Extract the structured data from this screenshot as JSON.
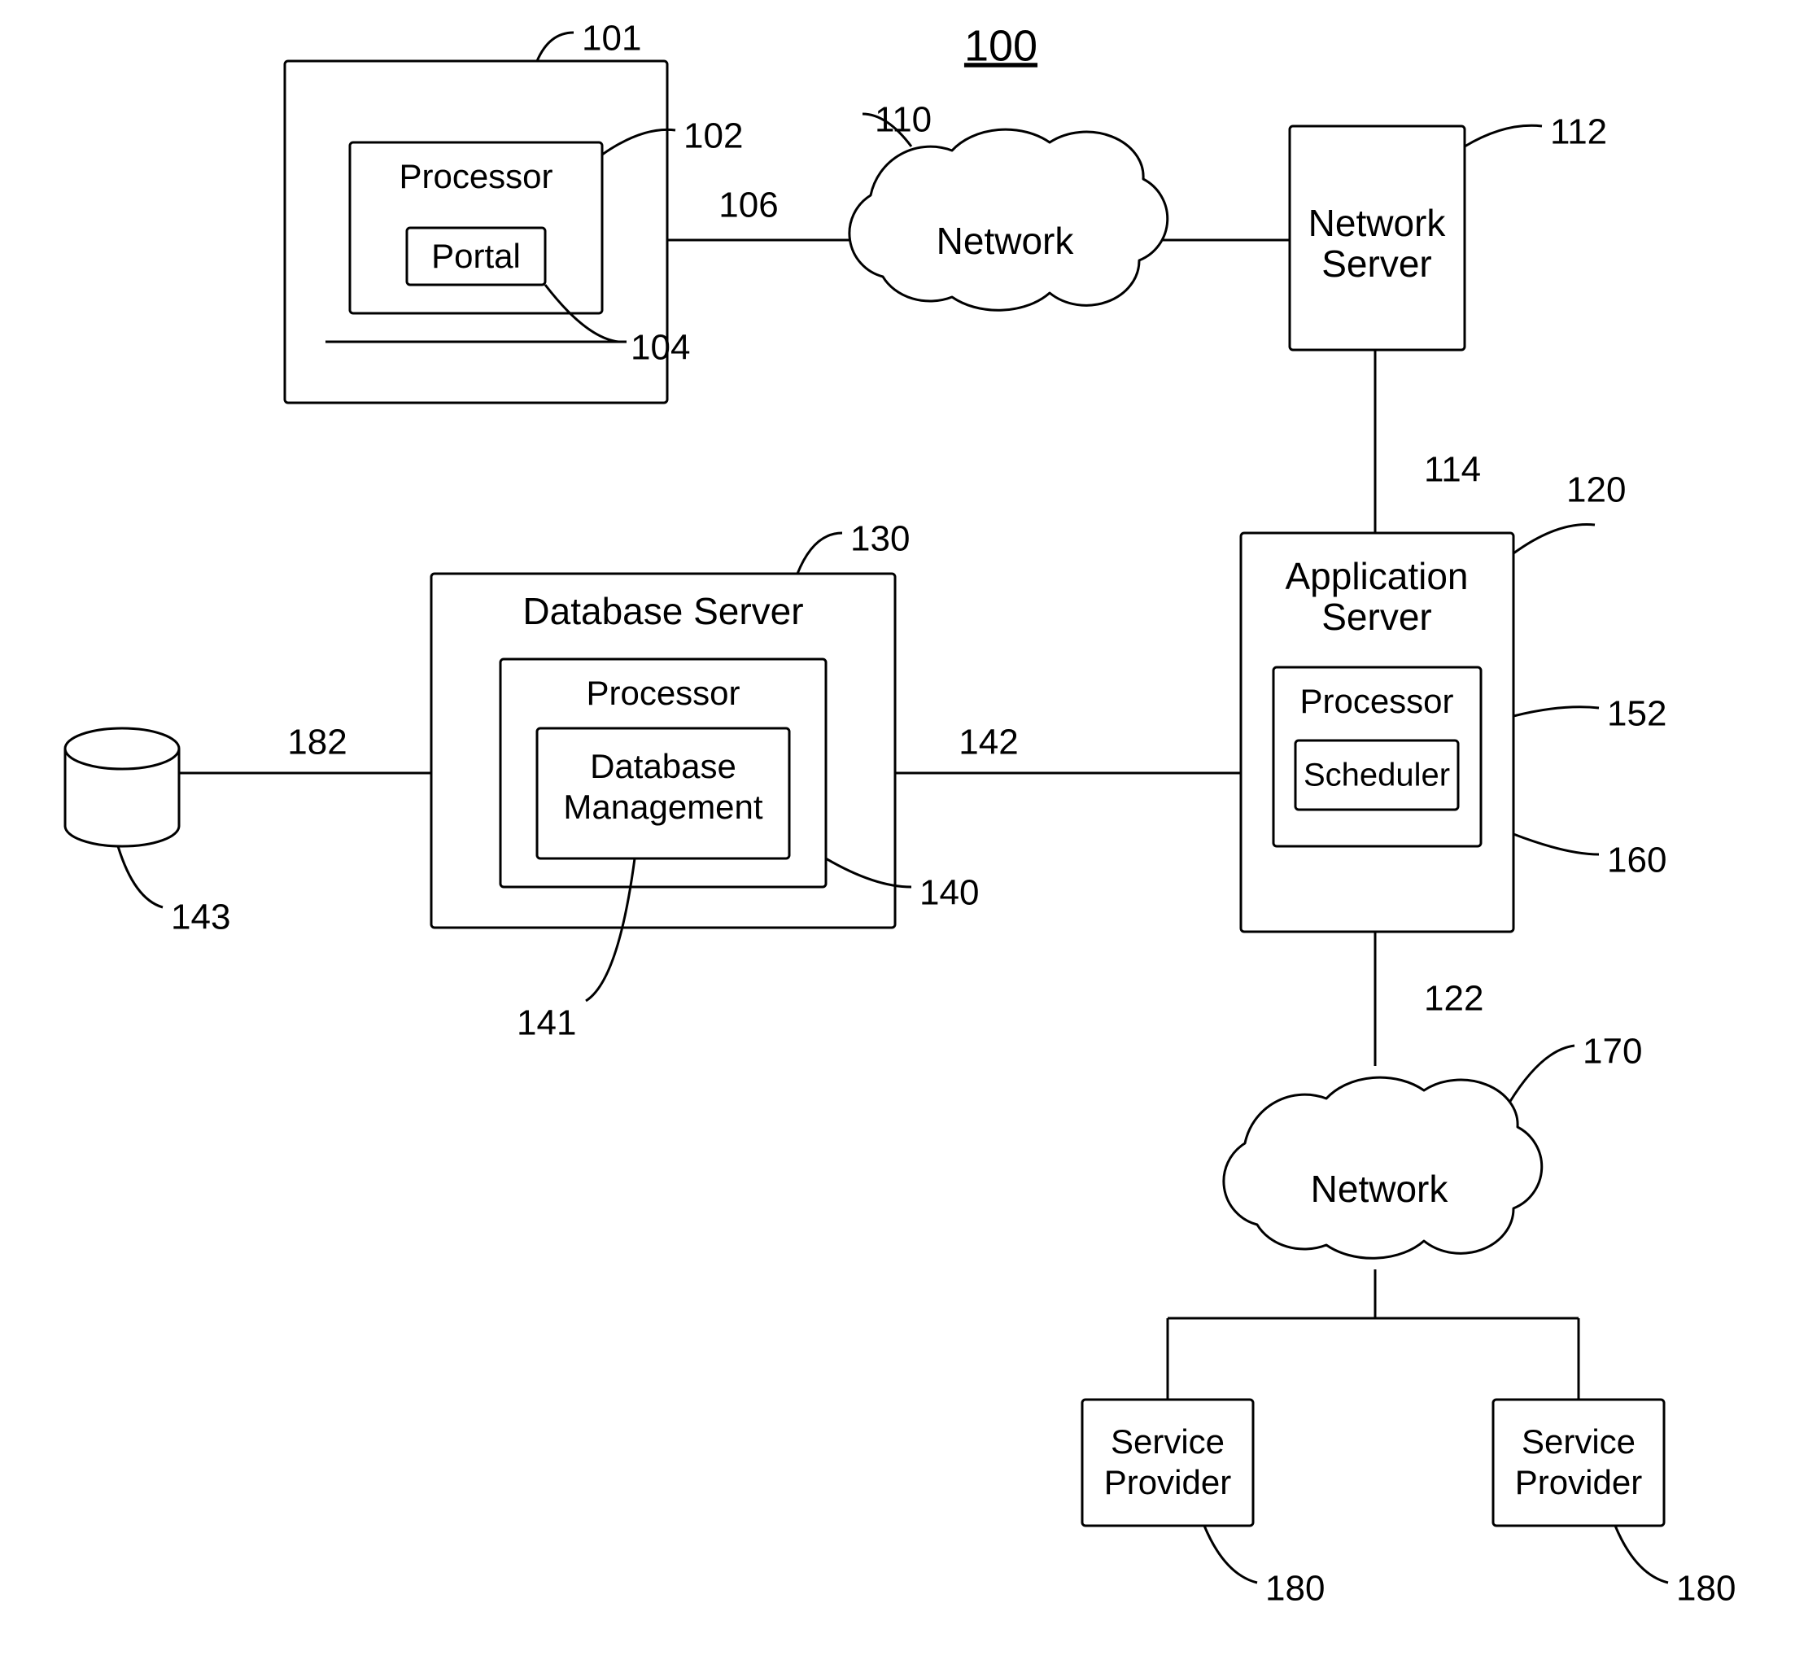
{
  "title": "100",
  "refs": {
    "r101": "101",
    "r102": "102",
    "r104": "104",
    "r106": "106",
    "r110": "110",
    "r112": "112",
    "r114": "114",
    "r120": "120",
    "r122": "122",
    "r130": "130",
    "r140": "140",
    "r141": "141",
    "r142": "142",
    "r143": "143",
    "r152": "152",
    "r160": "160",
    "r170": "170",
    "r180a": "180",
    "r180b": "180",
    "r182": "182"
  },
  "labels": {
    "processor1": "Processor",
    "portal": "Portal",
    "network1": "Network",
    "network_server_l1": "Network",
    "network_server_l2": "Server",
    "database_server": "Database Server",
    "processor2": "Processor",
    "db_mgmt_l1": "Database",
    "db_mgmt_l2": "Management",
    "app_server_l1": "Application",
    "app_server_l2": "Server",
    "processor3": "Processor",
    "scheduler": "Scheduler",
    "network2": "Network",
    "sp_l1": "Service",
    "sp_l2": "Provider"
  }
}
